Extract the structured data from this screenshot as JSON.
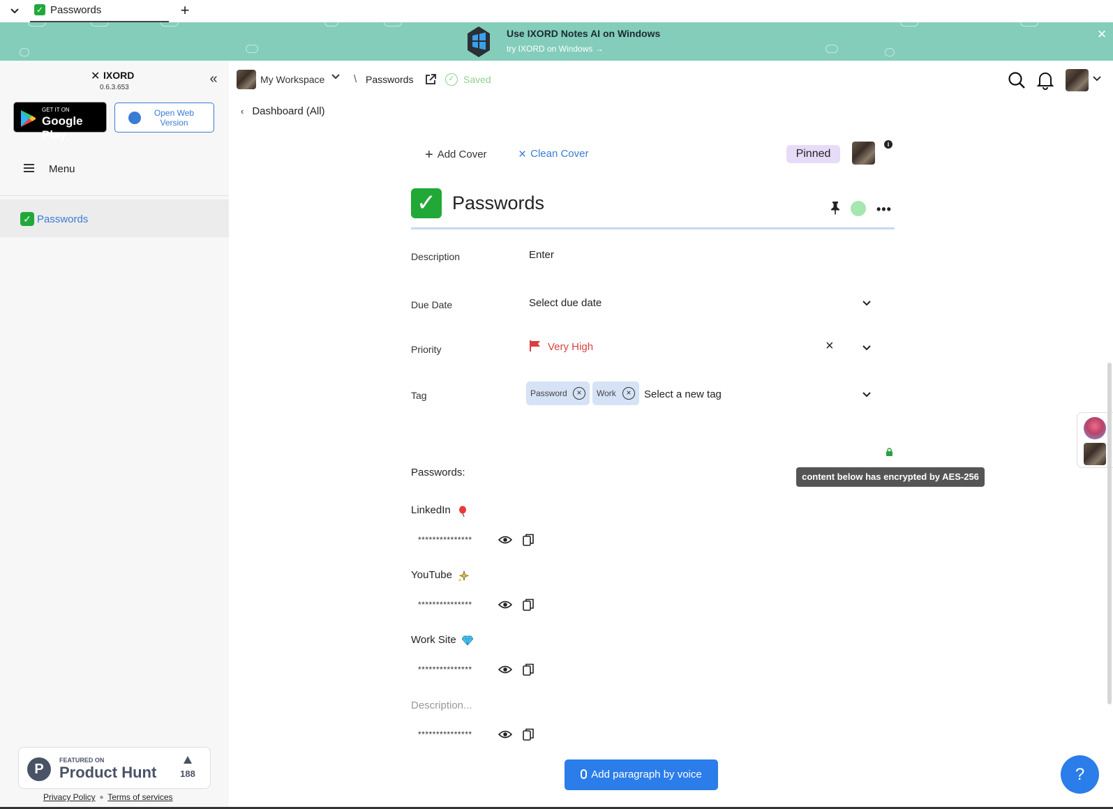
{
  "tab": {
    "title": "Passwords"
  },
  "banner": {
    "title": "Use IXORD Notes AI on Windows",
    "link": "try IXORD on Windows →"
  },
  "sidebar": {
    "brand": "IXORD",
    "version": "0.6.3.653",
    "gplay_small": "GET IT ON",
    "gplay_big": "Google Play",
    "web_version": "Open Web Version",
    "menu_label": "Menu",
    "items": [
      {
        "label": "Passwords"
      }
    ],
    "producthunt": {
      "featured": "FEATURED ON",
      "name": "Product Hunt",
      "count": "188"
    },
    "legal": {
      "privacy": "Privacy Policy",
      "terms": "Terms of services"
    }
  },
  "header": {
    "workspace": "My Workspace",
    "separator": "\\",
    "page": "Passwords",
    "saved": "Saved",
    "back": "Dashboard (All)"
  },
  "cover": {
    "add": "Add Cover",
    "clean": "Clean Cover",
    "pinned": "Pinned"
  },
  "note": {
    "title": "Passwords",
    "properties": {
      "description_label": "Description",
      "description_value": "Enter",
      "due_label": "Due Date",
      "due_value": "Select due date",
      "priority_label": "Priority",
      "priority_value": "Very High",
      "tag_label": "Tag",
      "tags": [
        "Password",
        "Work"
      ],
      "tag_placeholder": "Select a new tag"
    },
    "encrypted_tooltip": "content below has encrypted by AES-256",
    "passwords_heading": "Passwords:",
    "entries": [
      {
        "label": "LinkedIn",
        "value": "***************"
      },
      {
        "label": "YouTube",
        "value": "***************"
      },
      {
        "label": "Work Site",
        "value": "***************"
      },
      {
        "label": "Description...",
        "value": "***************"
      }
    ],
    "voice_button": "Add paragraph by voice",
    "help": "?"
  },
  "colors": {
    "accent": "#2b7de9",
    "banner": "#84cdbb",
    "priority": "#d94040",
    "saved": "#8cd18c",
    "tag_chip": "#d6e2f5",
    "pinned": "#e6dcf7"
  }
}
